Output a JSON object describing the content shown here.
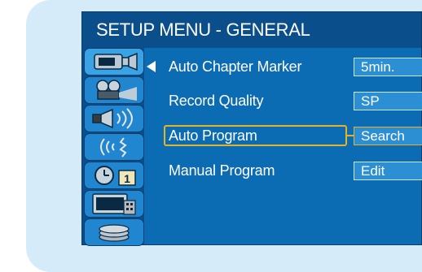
{
  "menu": {
    "title": "SETUP MENU - GENERAL",
    "items": [
      {
        "label": "Auto Chapter Marker",
        "value": "5min."
      },
      {
        "label": "Record Quality",
        "value": "SP"
      },
      {
        "label": "Auto Program",
        "value": "Search",
        "selected": true
      },
      {
        "label": "Manual Program",
        "value": "Edit"
      }
    ]
  },
  "sidebar": {
    "icons": [
      {
        "name": "camcorder-icon",
        "active": true
      },
      {
        "name": "film-projector-icon"
      },
      {
        "name": "speaker-icon"
      },
      {
        "name": "antenna-signal-icon"
      },
      {
        "name": "clock-calendar-icon"
      },
      {
        "name": "tv-remote-icon"
      },
      {
        "name": "disc-stack-icon"
      }
    ]
  },
  "colors": {
    "background": "#0b6bb3",
    "title_bar": "#0a4f8c",
    "value_box": "#2c8fd4",
    "highlight": "#e6b422",
    "frame": "#d6ebfa"
  }
}
